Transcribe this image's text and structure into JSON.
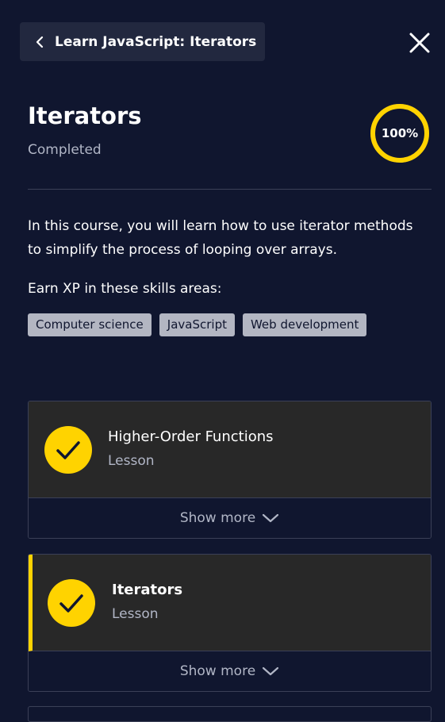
{
  "header": {
    "back_label": "Learn JavaScript: Iterators"
  },
  "course": {
    "title": "Iterators",
    "status": "Completed",
    "progress_label": "100%",
    "progress_value": 100,
    "description": "In this course, you will learn how to use iterator methods to simplify the process of looping over arrays.",
    "skills_heading": "Earn XP in these skills areas:",
    "skills": [
      "Computer science",
      "JavaScript",
      "Web development"
    ]
  },
  "lessons": [
    {
      "title": "Higher-Order Functions",
      "type": "Lesson",
      "show_more": "Show more",
      "completed": true
    },
    {
      "title": "Iterators",
      "type": "Lesson",
      "show_more": "Show more",
      "completed": true
    }
  ],
  "colors": {
    "background": "#10162f",
    "accent": "#ffd300",
    "card": "#282828",
    "tag": "#b3b6c2"
  },
  "icons": {
    "back": "chevron-left-icon",
    "close": "close-icon",
    "check": "check-icon",
    "expand": "chevron-down-icon"
  }
}
